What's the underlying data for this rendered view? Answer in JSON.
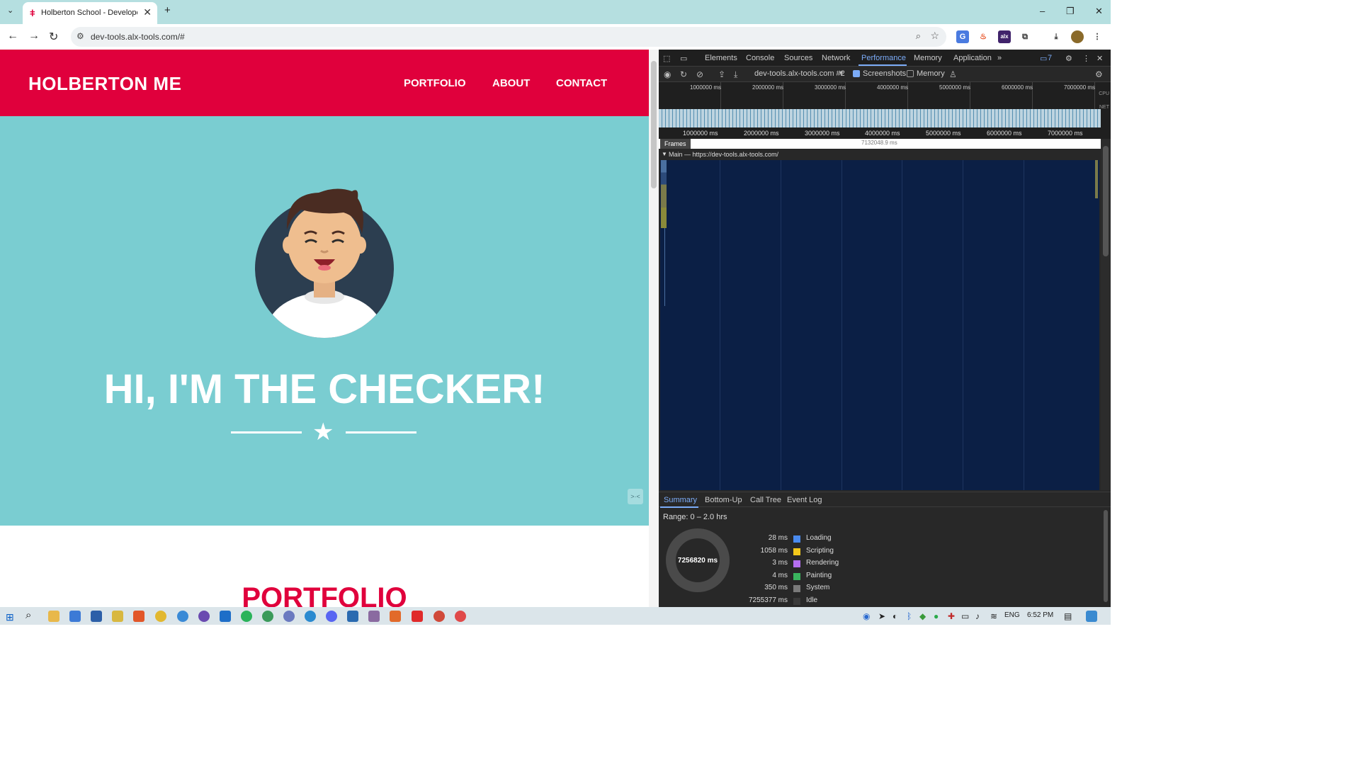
{
  "browser": {
    "tab_title": "Holberton School - Developer t",
    "tab_close": "✕",
    "new_tab": "+",
    "url": "dev-tools.alx-tools.com/#",
    "window_controls": [
      "–",
      "❐",
      "✕"
    ]
  },
  "site": {
    "brand": "HOLBERTON ME",
    "nav": [
      "PORTFOLIO",
      "ABOUT",
      "CONTACT"
    ],
    "hero_title": "HI, I'M THE CHECKER!",
    "section_title": "PORTFOLIO",
    "colors": {
      "primary": "#e0003c",
      "hero_bg": "#7acdd1"
    }
  },
  "devtools": {
    "tabs": [
      "Elements",
      "Console",
      "Sources",
      "Network",
      "Performance",
      "Memory",
      "Application"
    ],
    "active_tab": "Performance",
    "issues_count": "7",
    "target": "dev-tools.alx-tools.com #2",
    "screenshots_label": "Screenshots",
    "memory_label": "Memory",
    "overview_ticks": [
      "1000000 ms",
      "2000000 ms",
      "3000000 ms",
      "4000000 ms",
      "5000000 ms",
      "6000000 ms",
      "7000000 ms"
    ],
    "cpu_label": "CPU",
    "net_label": "NET",
    "frames_label": "Frames",
    "frames_value": "7132048.9 ms",
    "main_label": "Main — https://dev-tools.alx-tools.com/",
    "bottom_tabs": [
      "Summary",
      "Bottom-Up",
      "Call Tree",
      "Event Log"
    ],
    "range": "Range: 0 – 2.0 hrs",
    "total": "7256820 ms",
    "summary": [
      {
        "value": "28 ms",
        "label": "Loading",
        "color": "#4a8bef"
      },
      {
        "value": "1058 ms",
        "label": "Scripting",
        "color": "#f2c81b"
      },
      {
        "value": "3 ms",
        "label": "Rendering",
        "color": "#b46ef0"
      },
      {
        "value": "4 ms",
        "label": "Painting",
        "color": "#3ab55e"
      },
      {
        "value": "350 ms",
        "label": "System",
        "color": "#7a7a7a"
      },
      {
        "value": "7255377 ms",
        "label": "Idle",
        "color": "#3a3a3a"
      }
    ]
  },
  "taskbar": {
    "lang": "ENG",
    "time": "6:52 PM"
  }
}
